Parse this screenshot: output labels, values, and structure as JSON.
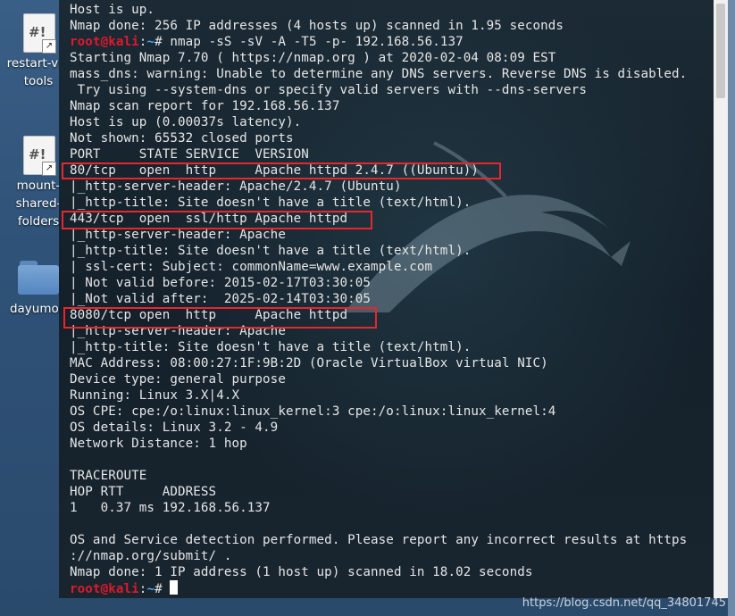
{
  "desktop": {
    "icons": [
      {
        "name": "restart-vm-tools",
        "label1": "restart-vm",
        "label2": "tools",
        "glyph": "#!",
        "icon": "script-file-icon"
      },
      {
        "name": "mount-shared-folders",
        "label1": "mount-",
        "label2": "shared-",
        "label3": "folders",
        "glyph": "#!",
        "icon": "script-file-icon"
      },
      {
        "name": "dayumori",
        "label1": "dayumori",
        "icon": "folder-icon"
      }
    ]
  },
  "terminal": {
    "prompt_user": "root@kali",
    "prompt_sep": ":",
    "prompt_path": "~",
    "prompt_suffix": "# ",
    "command": "nmap -sS -sV -A -T5 -p- 192.168.56.137",
    "lines": [
      "Host is up.",
      "Nmap done: 256 IP addresses (4 hosts up) scanned in 1.95 seconds",
      "",
      "Starting Nmap 7.70 ( https://nmap.org ) at 2020-02-04 08:09 EST",
      "mass_dns: warning: Unable to determine any DNS servers. Reverse DNS is disabled.",
      " Try using --system-dns or specify valid servers with --dns-servers",
      "Nmap scan report for 192.168.56.137",
      "Host is up (0.00037s latency).",
      "Not shown: 65532 closed ports",
      "PORT     STATE SERVICE  VERSION",
      "80/tcp   open  http     Apache httpd 2.4.7 ((Ubuntu))",
      "|_http-server-header: Apache/2.4.7 (Ubuntu)",
      "|_http-title: Site doesn't have a title (text/html).",
      "443/tcp  open  ssl/http Apache httpd",
      "|_http-server-header: Apache",
      "|_http-title: Site doesn't have a title (text/html).",
      "| ssl-cert: Subject: commonName=www.example.com",
      "| Not valid before: 2015-02-17T03:30:05",
      "|_Not valid after:  2025-02-14T03:30:05",
      "8080/tcp open  http     Apache httpd",
      "|_http-server-header: Apache",
      "|_http-title: Site doesn't have a title (text/html).",
      "MAC Address: 08:00:27:1F:9B:2D (Oracle VirtualBox virtual NIC)",
      "Device type: general purpose",
      "Running: Linux 3.X|4.X",
      "OS CPE: cpe:/o:linux:linux_kernel:3 cpe:/o:linux:linux_kernel:4",
      "OS details: Linux 3.2 - 4.9",
      "Network Distance: 1 hop",
      "",
      "TRACEROUTE",
      "HOP RTT     ADDRESS",
      "1   0.37 ms 192.168.56.137",
      "",
      "OS and Service detection performed. Please report any incorrect results at https",
      "://nmap.org/submit/ .",
      "Nmap done: 1 IP address (1 host up) scanned in 18.02 seconds",
      ""
    ]
  },
  "highlight_color": "#e8262b",
  "watermark": "https://blog.csdn.net/qq_34801745"
}
